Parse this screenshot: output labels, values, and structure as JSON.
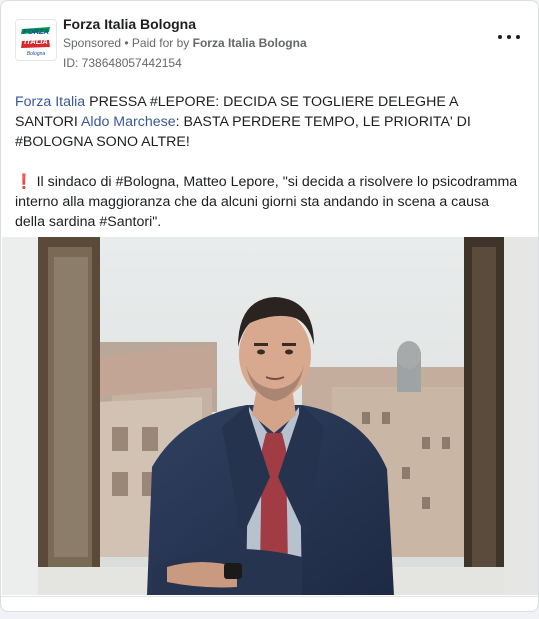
{
  "ad": {
    "page_name": "Forza Italia Bologna",
    "sponsored_label": "Sponsored",
    "bullet": " • ",
    "paid_for_prefix": "Paid for by ",
    "paid_for_name": "Forza Italia Bologna",
    "id_text": "ID: 738648057442154",
    "logo": {
      "line1": "FORZA",
      "line2": "ITALIA",
      "sub": "Bologna"
    },
    "more_icon": "more-horizontal-icon"
  },
  "post": {
    "mention1": "Forza Italia",
    "para1_part1": " PRESSA #LEPORE: DECIDA SE TOGLIERE DELEGHE A SANTORI ",
    "mention2": "Aldo Marchese",
    "para1_part2": ": BASTA PERDERE TEMPO, LE PRIORITA' DI #BOLOGNA SONO ALTRE!",
    "exclamation": "❗",
    "para2": " Il sindaco di #Bologna, Matteo Lepore, \"si decida a risolvere lo psicodramma interno alla maggioranza che da alcuni giorni sta andando in scena a causa della sardina #Santori\".",
    "ellipsis": "..."
  },
  "colors": {
    "link": "#385898",
    "text": "#1c1e21",
    "secondary": "#65676b",
    "logo_green": "#00963f",
    "logo_red": "#d7282f",
    "logo_blue": "#1d4e9e"
  }
}
